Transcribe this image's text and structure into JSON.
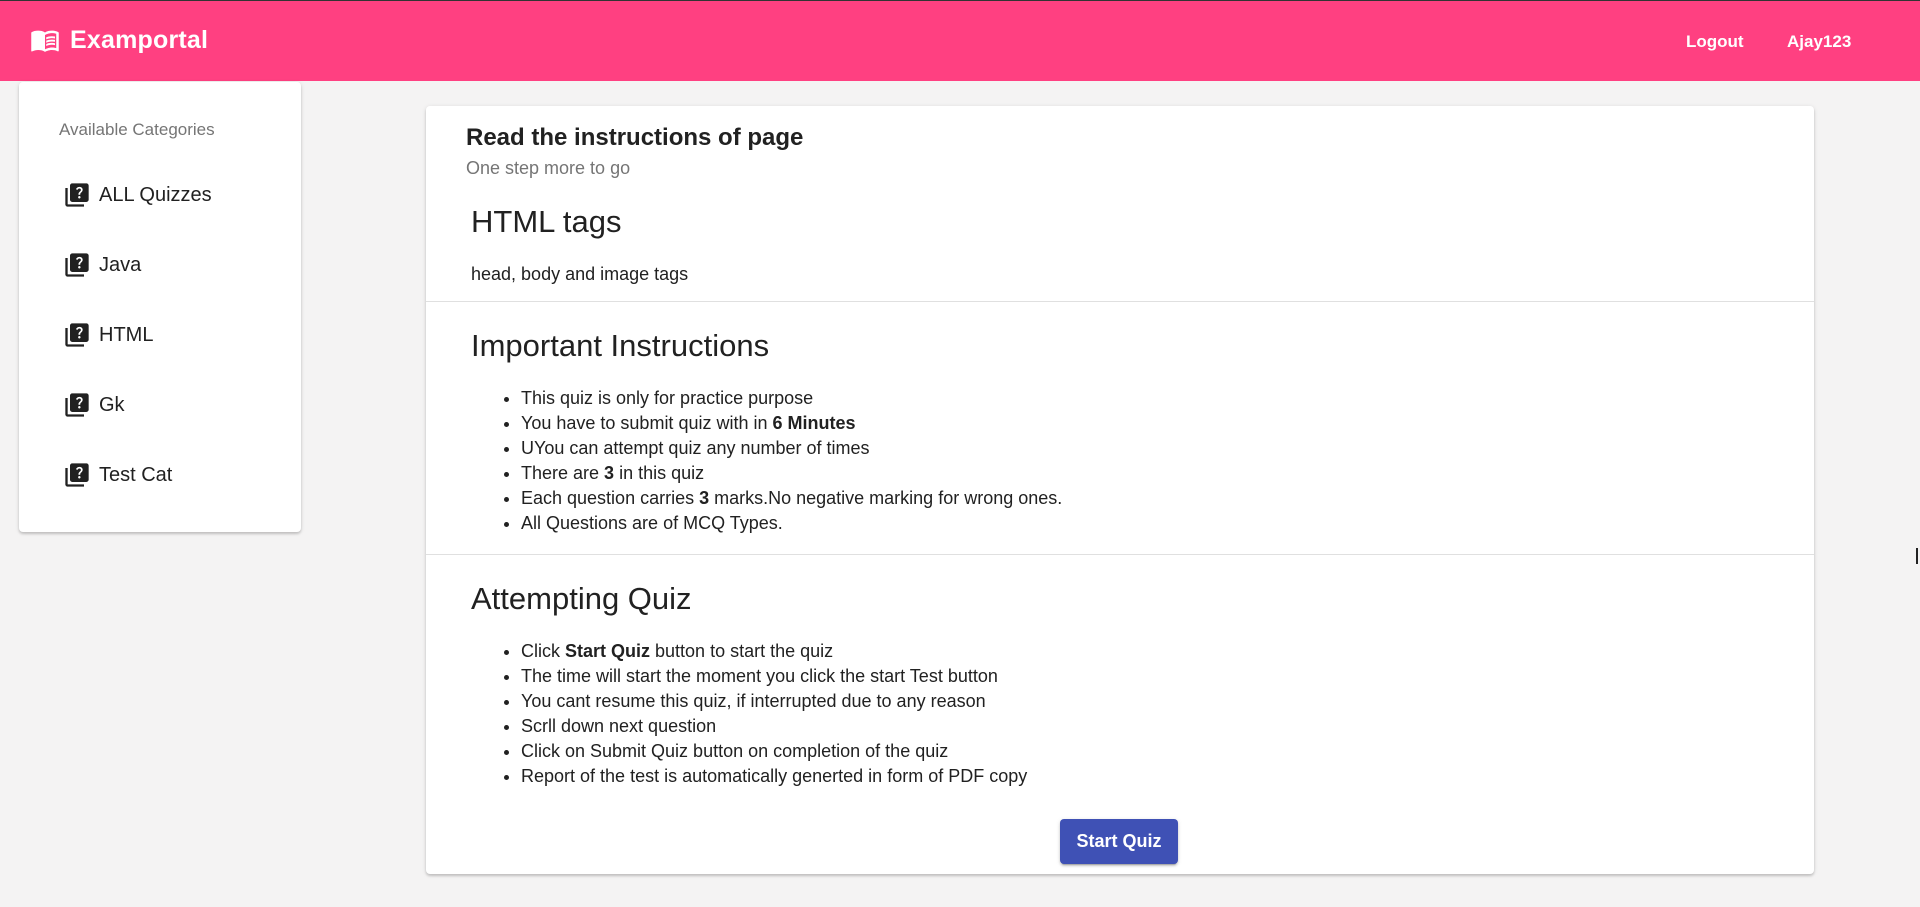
{
  "app": {
    "brand_title": "Examportal",
    "brand_icon": "menu-book-icon",
    "accent_color": "#ff4081",
    "primary_color": "#3f51b5"
  },
  "nav": {
    "logout_label": "Logout",
    "username": "Ajay123"
  },
  "sidebar": {
    "header": "Available Categories",
    "item_icon": "quiz-library-icon",
    "items": [
      {
        "label": "ALL Quizzes"
      },
      {
        "label": "Java"
      },
      {
        "label": "HTML"
      },
      {
        "label": "Gk"
      },
      {
        "label": "Test Cat"
      }
    ]
  },
  "card": {
    "title": "Read the instructions of page",
    "subtitle": "One step more to go"
  },
  "quiz": {
    "title": "HTML tags",
    "description": "head, body and image tags"
  },
  "important": {
    "heading": "Important Instructions",
    "items": [
      {
        "text": "This quiz is only for practice purpose"
      },
      {
        "pre": "You have to submit quiz with in ",
        "bold": "6 Minutes",
        "post": ""
      },
      {
        "text": "UYou can attempt quiz any number of times"
      },
      {
        "pre": "There are ",
        "bold": "3",
        "post": " in this quiz"
      },
      {
        "pre": "Each question carries ",
        "bold": "3",
        "post": " marks.No negative marking for wrong ones."
      },
      {
        "text": "All Questions are of MCQ Types."
      }
    ]
  },
  "attempting": {
    "heading": "Attempting Quiz",
    "items": [
      {
        "pre": "Click ",
        "bold": "Start Quiz",
        "post": " button to start the quiz"
      },
      {
        "text": "The time will start the moment you click the start Test button"
      },
      {
        "text": "You cant resume this quiz, if interrupted due to any reason"
      },
      {
        "text": "Scrll down next question"
      },
      {
        "text": "Click on Submit Quiz button on completion of the quiz"
      },
      {
        "text": "Report of the test is automatically generted in form of PDF copy"
      }
    ]
  },
  "actions": {
    "start_label": "Start Quiz"
  }
}
